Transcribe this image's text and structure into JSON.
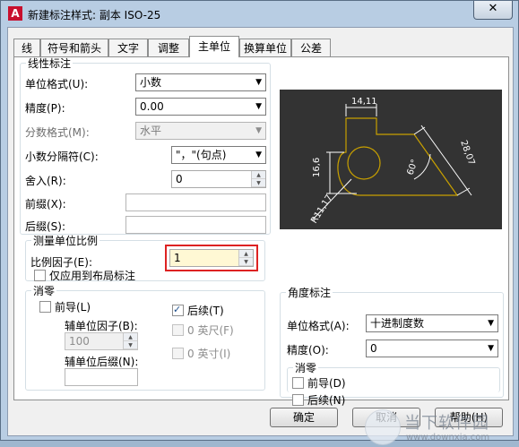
{
  "window": {
    "title": "新建标注样式: 副本 ISO-25",
    "close_label": "✕"
  },
  "tabs": [
    {
      "label": "线"
    },
    {
      "label": "符号和箭头"
    },
    {
      "label": "文字"
    },
    {
      "label": "调整"
    },
    {
      "label": "主单位",
      "active": true
    },
    {
      "label": "换算单位"
    },
    {
      "label": "公差"
    }
  ],
  "linear": {
    "legend": "线性标注",
    "unit_format_label": "单位格式(U):",
    "unit_format_value": "小数",
    "precision_label": "精度(P):",
    "precision_value": "0.00",
    "fraction_label": "分数格式(M):",
    "fraction_value": "水平",
    "decimal_sep_label": "小数分隔符(C):",
    "decimal_sep_value": "\"，\"(句点)",
    "round_label": "舍入(R):",
    "round_value": "0",
    "prefix_label": "前缀(X):",
    "prefix_value": "",
    "suffix_label": "后缀(S):",
    "suffix_value": ""
  },
  "scale": {
    "legend": "测量单位比例",
    "factor_label": "比例因子(E):",
    "factor_value": "1",
    "layout_only_label": "仅应用到布局标注"
  },
  "zero_linear": {
    "legend": "消零",
    "leading_label": "前导(L)",
    "trailing_label": "后续(T)",
    "sub_factor_label": "辅单位因子(B):",
    "sub_factor_value": "100",
    "sub_suffix_label": "辅单位后缀(N):",
    "feet_label": "0 英尺(F)",
    "inch_label": "0 英寸(I)"
  },
  "preview": {
    "dim_top": "14,11",
    "dim_left": "16,6",
    "dim_right": "28,07",
    "dim_angle": "60°",
    "dim_radius": "R11,17"
  },
  "angular": {
    "legend": "角度标注",
    "unit_format_label": "单位格式(A):",
    "unit_format_value": "十进制度数",
    "precision_label": "精度(O):",
    "precision_value": "0",
    "zero_legend": "消零",
    "leading_label": "前导(D)",
    "trailing_label": "后续(N)"
  },
  "buttons": {
    "ok": "确定",
    "cancel": "取消",
    "help": "帮助(H)"
  },
  "watermark": {
    "text": "当下软件园",
    "url": "www.downxia.com"
  },
  "colors": {
    "accent_frame": "#d22222",
    "preview_bg": "#333333",
    "preview_line": "#c8a000"
  }
}
